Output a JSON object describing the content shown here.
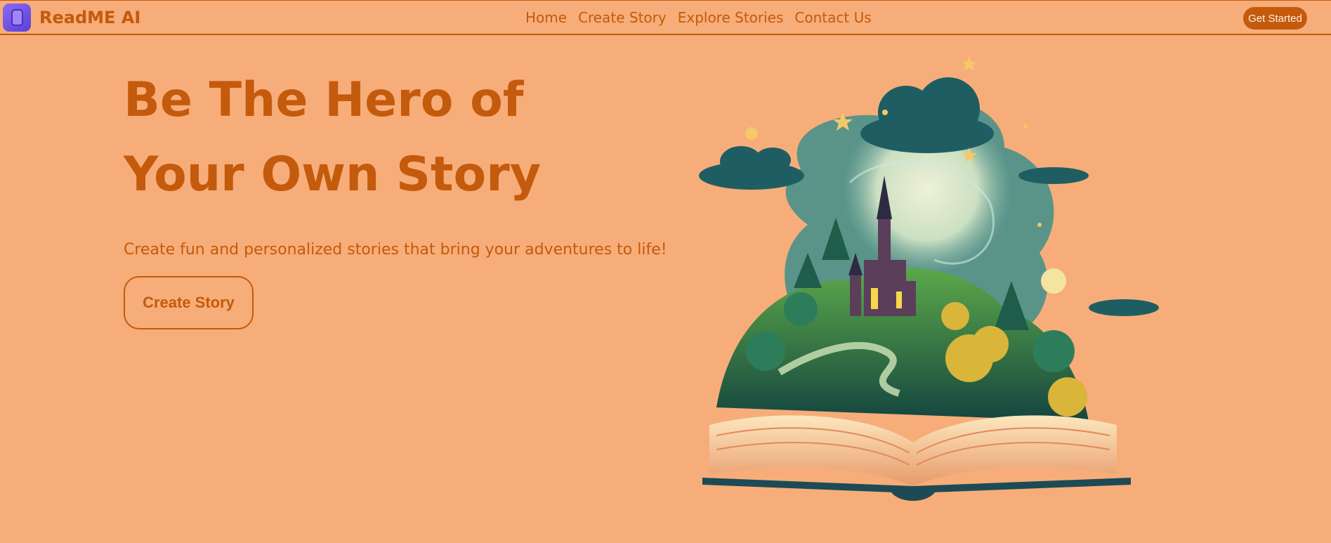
{
  "nav": {
    "brand": "ReadME AI",
    "links": [
      {
        "label": "Home"
      },
      {
        "label": "Create Story"
      },
      {
        "label": "Explore Stories"
      },
      {
        "label": "Contact Us"
      }
    ],
    "cta": "Get Started"
  },
  "hero": {
    "title": "Be The Hero of Your Own Story",
    "subtitle": "Create fun and personalized stories that bring your adventures to life!",
    "button": "Create Story"
  },
  "colors": {
    "background": "#F7AD79",
    "accent": "#C45A0C",
    "logo": "#7B5CF0"
  },
  "icons": {
    "logo": "app-logo-icon"
  }
}
